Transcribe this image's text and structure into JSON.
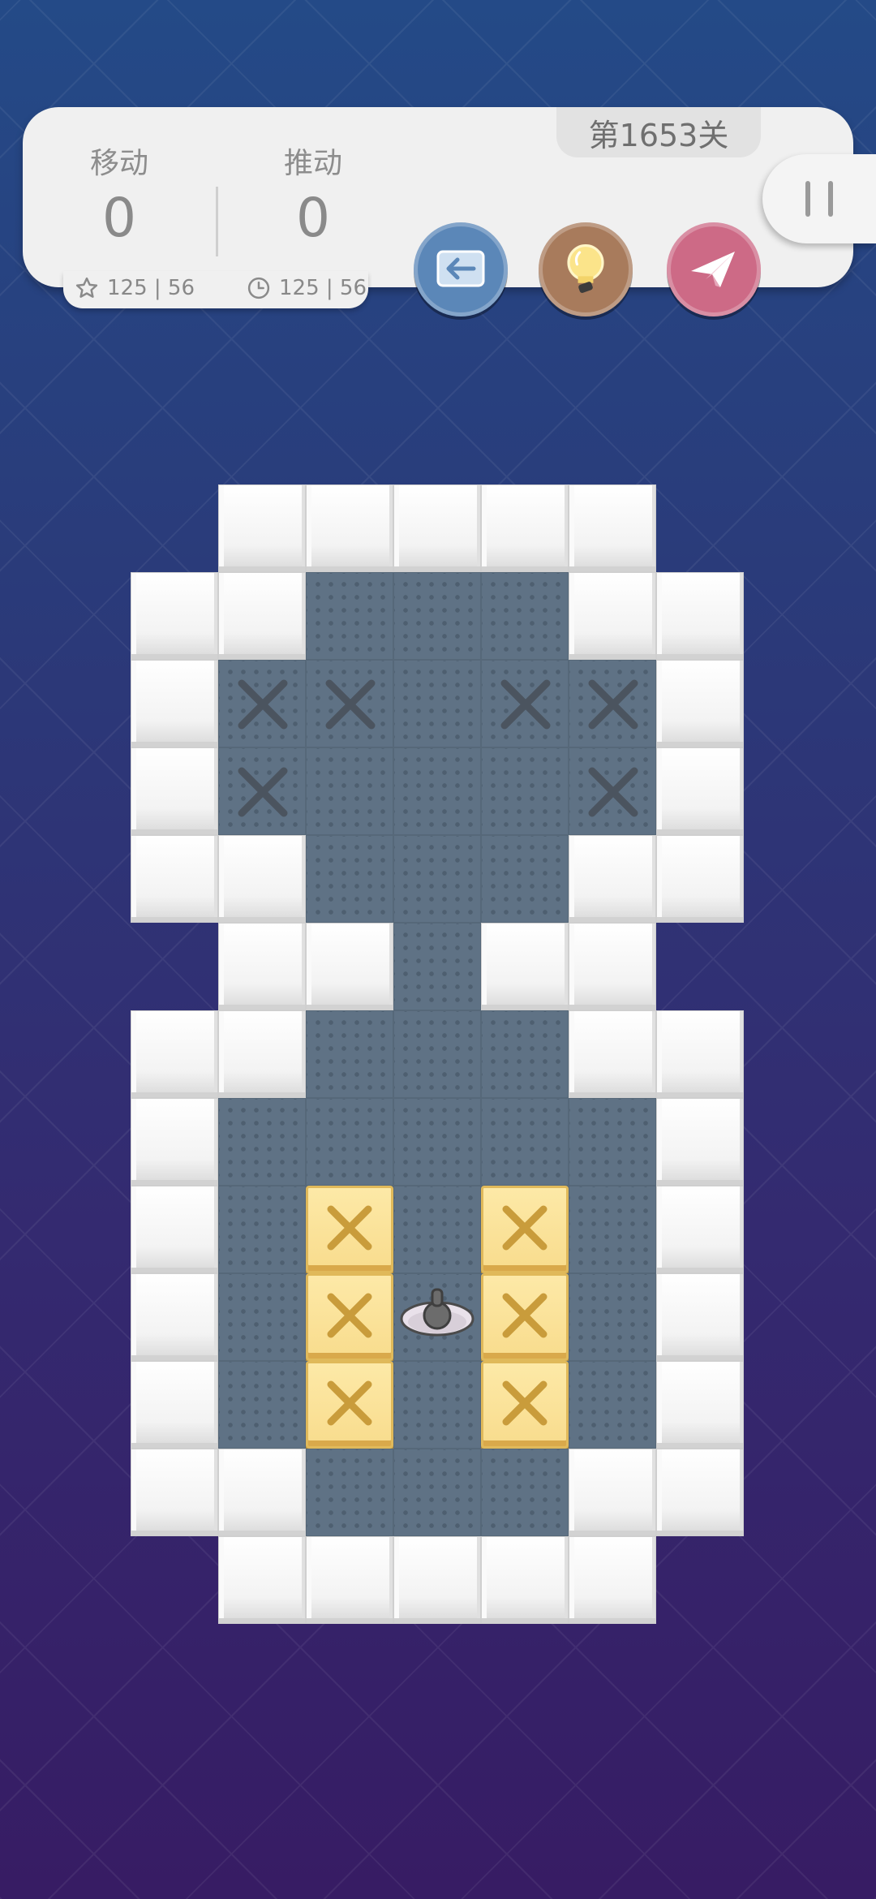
{
  "header": {
    "moves_label": "移动",
    "moves_value": "0",
    "pushes_label": "推动",
    "pushes_value": "0",
    "level_label": "第1653关",
    "star_record": "125 | 56",
    "time_record": "125 | 56"
  },
  "buttons": {
    "undo_icon": "back-arrow-icon",
    "hint_icon": "lightbulb-icon",
    "share_icon": "paper-plane-icon",
    "pause_icon": "pause-icon"
  },
  "colors": {
    "undo": "#5b87b8",
    "hint": "#a87b5c",
    "share": "#cd6a86",
    "floor": "#5f7285",
    "box": "#f8dc8d"
  },
  "board": {
    "map": [
      "  WWWWW  ",
      " WW...WW ",
      " WGG.GGW ",
      " WG...GW ",
      " WW...WW ",
      "  WW.WW  ",
      " WW...WW ",
      " W.....W ",
      " W.B.B.W ",
      " W.BPB.W ",
      " W.B.B.W ",
      " WW...WW ",
      "  WWWWW  "
    ],
    "legend": {
      "W": "wall",
      ".": "floor",
      "G": "goal",
      "B": "box",
      "P": "player"
    }
  }
}
